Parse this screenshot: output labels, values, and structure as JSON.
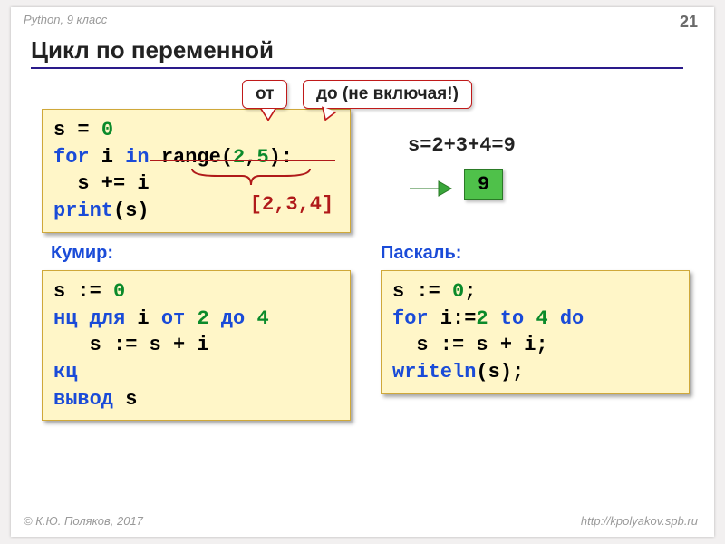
{
  "header": "Python, 9 класс",
  "page": "21",
  "title": "Цикл по переменной",
  "callout_from": "от",
  "callout_to": "до (не включая!)",
  "py": {
    "l1a": "s = ",
    "l1b": "0",
    "l2a": "for",
    "l2b": " i ",
    "l2c": "in",
    "l2d": " range(",
    "l2e": "2",
    "l2f": ",",
    "l2g": "5",
    "l2h": "):",
    "l3": "  s += i",
    "l4a": "print",
    "l4b": "(s)"
  },
  "range_values": "[2,3,4]",
  "equation": "s=2+3+4=9",
  "result": "9",
  "label_kumir": "Кумир:",
  "label_pascal": "Паскаль:",
  "kumir": {
    "l1a": "s := ",
    "l1b": "0",
    "l2a": "нц для",
    "l2b": " i ",
    "l2c": "от",
    "l2d": " ",
    "l2e": "2",
    "l2f": " ",
    "l2g": "до",
    "l2h": " ",
    "l2i": "4",
    "l3": "   s := s + i",
    "l4": "кц",
    "l5a": "вывод",
    "l5b": " s"
  },
  "pascal": {
    "l1a": "s := ",
    "l1b": "0",
    "l1c": ";",
    "l2a": "for",
    "l2b": " i:=",
    "l2c": "2",
    "l2d": " ",
    "l2e": "to",
    "l2f": " ",
    "l2g": "4",
    "l2h": " ",
    "l2i": "do",
    "l3": "  s := s + i;",
    "l4a": "writeln",
    "l4b": "(s);"
  },
  "footer_left": "© К.Ю. Поляков, 2017",
  "footer_right": "http://kpolyakov.spb.ru"
}
